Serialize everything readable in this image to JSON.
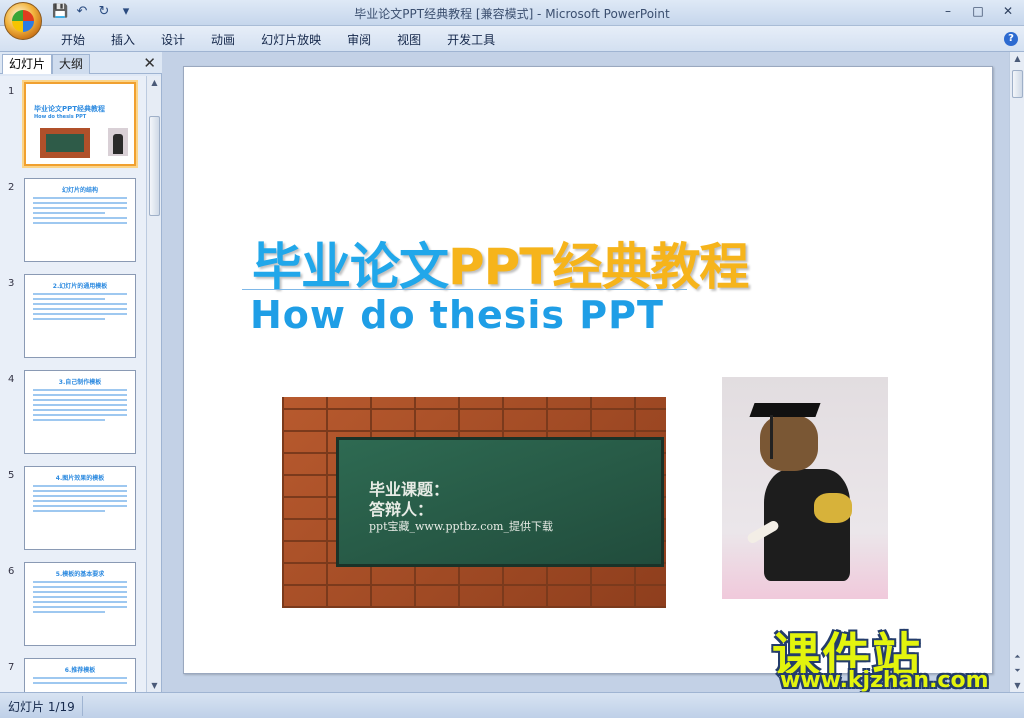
{
  "window": {
    "title": "毕业论文PPT经典教程 [兼容模式] - Microsoft PowerPoint",
    "minimize": "–",
    "maximize": "□",
    "close": "✕"
  },
  "quick_access": [
    {
      "icon": "save-icon",
      "glyph": "💾"
    },
    {
      "icon": "undo-icon",
      "glyph": "↶"
    },
    {
      "icon": "redo-icon",
      "glyph": "↻"
    },
    {
      "icon": "customize-icon",
      "glyph": "▾"
    }
  ],
  "ribbon": {
    "tabs": [
      "开始",
      "插入",
      "设计",
      "动画",
      "幻灯片放映",
      "审阅",
      "视图",
      "开发工具"
    ]
  },
  "left_panel": {
    "tab_slides": "幻灯片",
    "tab_outline": "大纲",
    "close": "✕",
    "thumbnails": [
      {
        "number": "1",
        "title": "毕业论文PPT经典教程",
        "subtitle": "How do thesis PPT"
      },
      {
        "number": "2",
        "title": "幻灯片的结构"
      },
      {
        "number": "3",
        "title": "2.幻灯片的通用模板"
      },
      {
        "number": "4",
        "title": "3.自己制作模板"
      },
      {
        "number": "5",
        "title": "4.图片效果的模板"
      },
      {
        "number": "6",
        "title": "5.模板的基本要求"
      },
      {
        "number": "7",
        "title": "6.推荐模板"
      }
    ]
  },
  "slide": {
    "title_blue": "毕业论文",
    "title_orange": "PPT经典教程",
    "subtitle": "How do thesis PPT",
    "board_line1": "毕业课题：",
    "board_line2": "答辩人：",
    "board_line3": "ppt宝藏_www.pptbz.com_提供下载"
  },
  "watermark": {
    "cn": "课件站",
    "en": "www.kjzhan.com"
  },
  "statusbar": {
    "slide_indicator": "幻灯片 1/19"
  },
  "colors": {
    "title_blue": "#21a7ea",
    "title_orange": "#f6b41b",
    "selection": "#f0a030"
  }
}
